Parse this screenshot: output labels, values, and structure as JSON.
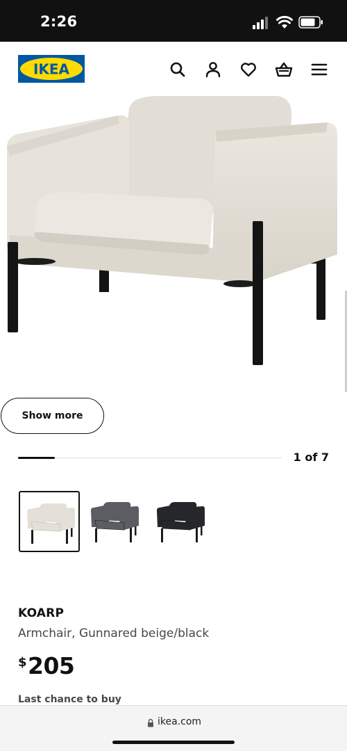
{
  "status_bar": {
    "time": "2:26"
  },
  "header": {
    "logo_text": "IKEA",
    "icons": [
      "search-icon",
      "account-icon",
      "heart-icon",
      "cart-icon",
      "menu-icon"
    ]
  },
  "gallery": {
    "show_more_label": "Show more",
    "counter": "1 of 7",
    "progress": 0.14
  },
  "variants": [
    {
      "name": "Gunnared beige/black",
      "selected": true,
      "color": "#e4e0d8"
    },
    {
      "name": "grey",
      "selected": false,
      "color": "#5b5d62"
    },
    {
      "name": "black",
      "selected": false,
      "color": "#26272a"
    }
  ],
  "product": {
    "name": "KOARP",
    "description": "Armchair, Gunnared beige/black",
    "currency": "$",
    "price": "205",
    "notice": "Last chance to buy"
  },
  "browser": {
    "url": "ikea.com"
  },
  "colors": {
    "brand_blue": "#0058a3",
    "brand_yellow": "#ffdb00"
  }
}
